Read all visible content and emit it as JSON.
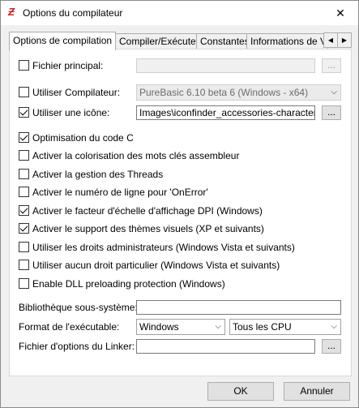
{
  "window": {
    "title": "Options du compilateur",
    "close": "✕"
  },
  "tabs": [
    "Options de compilation",
    "Compiler/Exécuter",
    "Constantes",
    "Informations de V"
  ],
  "main_file": {
    "label": "Fichier principal:",
    "checked": false,
    "value": "",
    "browse": "..."
  },
  "compiler": {
    "label": "Utiliser Compilateur:",
    "checked": false,
    "selected": "PureBasic 6.10 beta 6 (Windows - x64)"
  },
  "icon": {
    "label": "Utiliser une icône:",
    "checked": true,
    "value": "Images\\iconfinder_accessories-character-m",
    "browse": "..."
  },
  "options": [
    {
      "label": "Optimisation du code C",
      "checked": true
    },
    {
      "label": "Activer la colorisation des mots clés assembleur",
      "checked": false
    },
    {
      "label": "Activer la gestion des Threads",
      "checked": false
    },
    {
      "label": "Activer le numéro de ligne pour 'OnError'",
      "checked": false
    },
    {
      "label": "Activer le facteur d'échelle d'affichage DPI (Windows)",
      "checked": true
    },
    {
      "label": "Activer le support des thèmes visuels (XP et suivants)",
      "checked": true
    },
    {
      "label": "Utiliser les droits administrateurs (Windows Vista et suivants)",
      "checked": false
    },
    {
      "label": "Utiliser aucun droit particulier (Windows Vista et suivants)",
      "checked": false
    },
    {
      "label": "Enable DLL preloading protection (Windows)",
      "checked": false
    }
  ],
  "subsystem": {
    "label": "Bibliothèque sous-système:",
    "value": ""
  },
  "exe_format": {
    "label": "Format de l'exécutable:",
    "format": "Windows",
    "cpu": "Tous les CPU"
  },
  "linker": {
    "label": "Fichier d'options du Linker:",
    "value": "",
    "browse": "..."
  },
  "buttons": {
    "ok": "OK",
    "cancel": "Annuler"
  }
}
